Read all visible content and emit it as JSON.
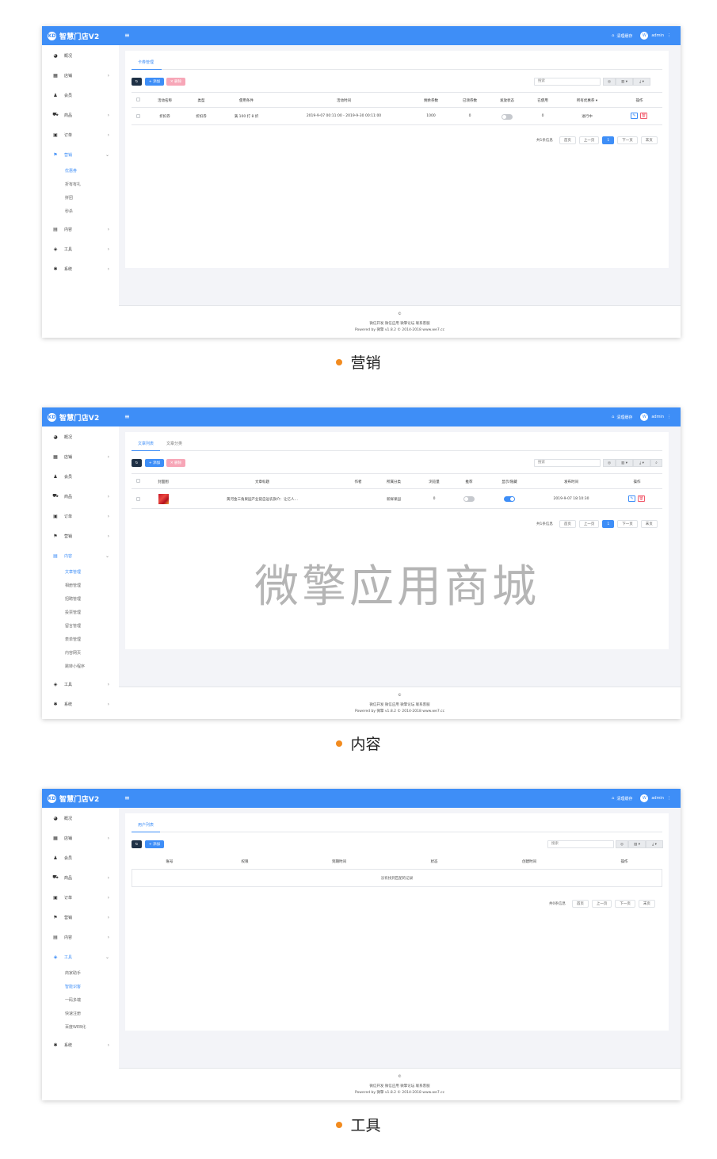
{
  "brand": "智慧门店V2",
  "logo_text": "KD",
  "top": {
    "clear_cache": "清理缓存",
    "user": "admin",
    "avatar": "W"
  },
  "sidebar": {
    "overview": "概况",
    "shop": "店铺",
    "member": "会员",
    "goods": "商品",
    "order": "订单",
    "marketing": "营销",
    "content": "内容",
    "tools": "工具",
    "system": "系统"
  },
  "s1": {
    "caption": "营销",
    "sub": [
      "优惠券",
      "折有有礼",
      "拼团",
      "秒杀"
    ],
    "tab": "卡券管理",
    "btn_add": "+ 添加",
    "btn_del": "✕ 删除",
    "search_placeholder": "搜索",
    "headers": [
      "活动名称",
      "类型",
      "使用条件",
      "活动时间",
      "剩余券数",
      "已领券数",
      "发放状态",
      "已使用",
      "所有优惠券 ▾",
      "操作"
    ],
    "row": [
      "折扣券",
      "折扣券",
      "满 100 打 8 折",
      "2019-9-07 00:11:00 - 2019-9-30 00:11:00",
      "1000",
      "0",
      "0",
      "进行中"
    ],
    "pager": {
      "info": "共1条信息",
      "first": "首页",
      "prev": "上一页",
      "cur": "1",
      "next": "下一页",
      "last": "末页"
    }
  },
  "s2": {
    "caption": "内容",
    "sub": [
      "文章管理",
      "相册管理",
      "招聘管理",
      "投票管理",
      "留言管理",
      "表单管理",
      "内容网页",
      "跳转小程序"
    ],
    "tabs": [
      "文章列表",
      "文章分类"
    ],
    "btn_add": "+ 添加",
    "btn_del": "✕ 删除",
    "search_placeholder": "搜索",
    "headers": [
      "封面图",
      "文章标题",
      "作者",
      "所属分类",
      "浏览量",
      "推荐",
      "显示/隐藏",
      "发布时间",
      "操作"
    ],
    "row": [
      "黄河金三角果园产业链自运农旗介：让亿人…",
      "新鲜果园",
      "0",
      "2019-9-07 18:10:30"
    ],
    "pager": {
      "info": "共1条信息",
      "first": "首页",
      "prev": "上一页",
      "cur": "1",
      "next": "下一页",
      "last": "末页"
    },
    "watermark": "微擎应用商城"
  },
  "s3": {
    "caption": "工具",
    "sub": [
      "商家助手",
      "智能识客",
      "一码多端",
      "快速注册",
      "百度WEB化"
    ],
    "tab": "用户列表",
    "btn_add": "+ 添加",
    "search_placeholder": "搜索",
    "headers": [
      "账号",
      "权限",
      "到期时间",
      "状态",
      "创建时间",
      "操作"
    ],
    "empty": "没有找到匹配的记录",
    "pager": {
      "info": "共0条信息",
      "first": "首页",
      "prev": "上一页",
      "next": "下一页",
      "last": "末页"
    }
  },
  "footer": {
    "line1": "©",
    "line2": "微信开发 微信应用 微擎论坛 联系客服",
    "line3": "Powered by 微擎 v1.8.2 © 2014-2018 www.we7.cc"
  }
}
